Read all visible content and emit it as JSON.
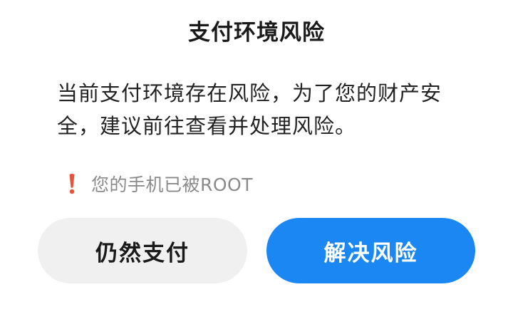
{
  "dialog": {
    "title": "支付环境风险",
    "message": "当前支付环境存在风险，为了您的财产安全，建议前往查看并处理风险。",
    "warning": {
      "icon": "exclamation-icon",
      "icon_color": "#e8523d",
      "text": "您的手机已被ROOT"
    },
    "buttons": {
      "continue_label": "仍然支付",
      "resolve_label": "解决风险"
    },
    "colors": {
      "primary": "#1a87f3",
      "secondary_bg": "#f0f0f0",
      "warning": "#e8523d"
    }
  }
}
